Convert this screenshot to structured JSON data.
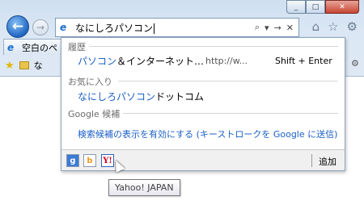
{
  "window": {
    "buttons": [
      "_",
      "□",
      "✕"
    ]
  },
  "address_bar": {
    "value": "なにしろパソコン",
    "tools": [
      "⌕",
      "▾",
      "→",
      "✕"
    ]
  },
  "command_icons": [
    "⌂",
    "☆",
    "⚙"
  ],
  "tab": {
    "label": "空白のペ"
  },
  "favorites_bar": {
    "folder_label": "な"
  },
  "dropdown": {
    "history": {
      "heading": "履歴",
      "item_title": "パソコン",
      "item_title_rest": "＆インターネット…",
      "item_url": "http://w...",
      "item_shortcut": "Shift + Enter"
    },
    "favorites": {
      "heading": "お気に入り",
      "item_highlight": "なにしろパソコン",
      "item_rest": "ドットコム"
    },
    "google": {
      "heading": "Google 候補",
      "link": "検索候補の表示を有効にする (キーストロークを Google に送信)"
    },
    "providers": [
      {
        "name": "google",
        "glyph": "g"
      },
      {
        "name": "bing",
        "glyph": "b"
      },
      {
        "name": "yahoo",
        "glyph": "Y!"
      }
    ],
    "add_label": "追加"
  },
  "tooltip": {
    "text": "Yahoo! JAPAN"
  }
}
